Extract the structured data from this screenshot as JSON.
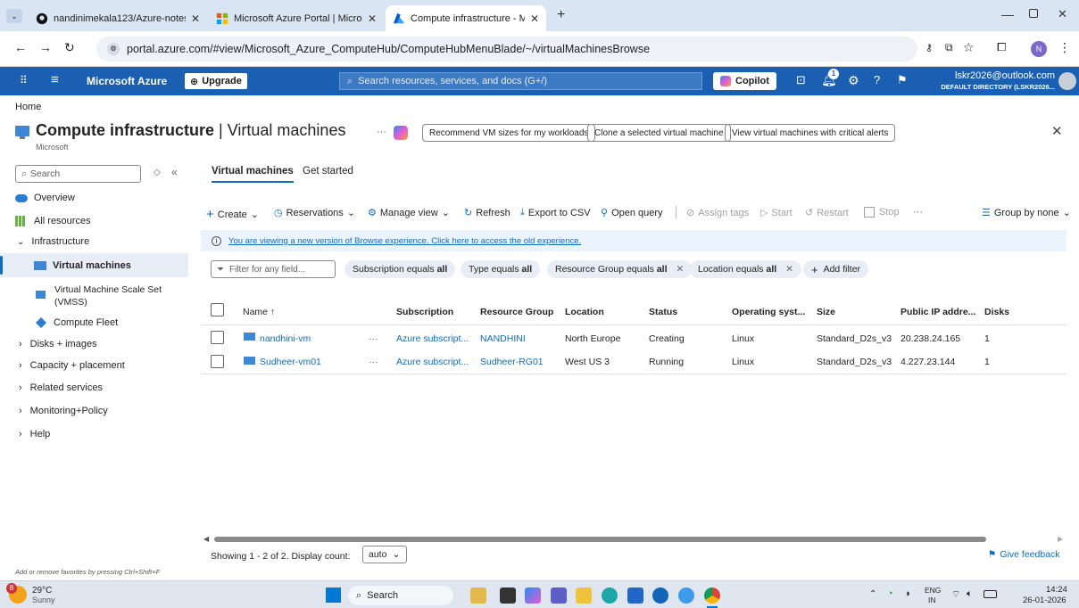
{
  "browser": {
    "tabs": [
      {
        "title": "nandinimekala123/Azure-notes",
        "icon": "github-icon"
      },
      {
        "title": "Microsoft Azure Portal | Micros",
        "icon": "microsoft-icon"
      },
      {
        "title": "Compute infrastructure - Micro",
        "icon": "azure-icon"
      }
    ],
    "url": "portal.azure.com/#view/Microsoft_Azure_ComputeHub/ComputeHubMenuBlade/~/virtualMachinesBrowse"
  },
  "azure_header": {
    "brand": "Microsoft Azure",
    "upgrade": "Upgrade",
    "search_placeholder": "Search resources, services, and docs (G+/)",
    "copilot": "Copilot",
    "notification_count": "1",
    "account_email": "lskr2026@outlook.com",
    "account_directory": "DEFAULT DIRECTORY (LSKR2026..."
  },
  "breadcrumb": "Home",
  "blade": {
    "title_main": "Compute infrastructure",
    "title_sep": " | ",
    "title_sub": "Virtual machines",
    "subtitle": "Microsoft",
    "more": "···",
    "suggestions": [
      "Recommend VM sizes for my workloads",
      "Clone a selected virtual machine",
      "View virtual machines with critical alerts"
    ]
  },
  "sidebar": {
    "search_placeholder": "Search",
    "items": [
      {
        "label": "Overview"
      },
      {
        "label": "All resources"
      },
      {
        "label": "Infrastructure"
      },
      {
        "label": "Virtual machines"
      },
      {
        "label": "Virtual Machine Scale Set"
      },
      {
        "label": "(VMSS)"
      },
      {
        "label": "Compute Fleet"
      },
      {
        "label": "Disks + images"
      },
      {
        "label": "Capacity + placement"
      },
      {
        "label": "Related services"
      },
      {
        "label": "Monitoring+Policy"
      },
      {
        "label": "Help"
      }
    ],
    "footer_hint": "Add or remove favorites by pressing Ctrl+Shift+F"
  },
  "tabs": {
    "active": "Virtual machines",
    "other": "Get started"
  },
  "toolbar": {
    "create": "Create",
    "reservations": "Reservations",
    "manage_view": "Manage view",
    "refresh": "Refresh",
    "export_csv": "Export to CSV",
    "open_query": "Open query",
    "assign_tags": "Assign tags",
    "start": "Start",
    "restart": "Restart",
    "stop": "Stop",
    "more": "···",
    "group_by": "Group by none"
  },
  "banner": "You are viewing a new version of Browse experience. Click here to access the old experience.",
  "filters": {
    "placeholder": "Filter for any field...",
    "chips": [
      {
        "label": "Subscription equals ",
        "value": "all"
      },
      {
        "label": "Type equals ",
        "value": "all"
      },
      {
        "label": "Resource Group equals ",
        "value": "all"
      },
      {
        "label": "Location equals ",
        "value": "all"
      }
    ],
    "add": "Add filter"
  },
  "table": {
    "columns": [
      "Name ↑",
      "Subscription",
      "Resource Group",
      "Location",
      "Status",
      "Operating syst...",
      "Size",
      "Public IP addre...",
      "Disks"
    ],
    "rows": [
      {
        "name": "nandhini-vm",
        "more": "···",
        "subscription": "Azure subscript...",
        "rg": "NANDHINI",
        "location": "North Europe",
        "status": "Creating",
        "os": "Linux",
        "size": "Standard_D2s_v3",
        "ip": "20.238.24.165",
        "disks": "1"
      },
      {
        "name": "Sudheer-vm01",
        "more": "···",
        "subscription": "Azure subscript...",
        "rg": "Sudheer-RG01",
        "location": "West US 3",
        "status": "Running",
        "os": "Linux",
        "size": "Standard_D2s_v3",
        "ip": "4.227.23.144",
        "disks": "1"
      }
    ]
  },
  "footer": {
    "showing": "Showing 1 - 2 of 2. Display count:",
    "count_value": "auto",
    "feedback": "Give feedback"
  },
  "taskbar": {
    "weather_badge": "8",
    "temperature": "29°C",
    "condition": "Sunny",
    "search": "Search",
    "lang1": "ENG",
    "lang2": "IN",
    "time": "14:24",
    "date": "26-01-2026"
  },
  "colors": {
    "azure_blue": "#1b5fb3",
    "link": "#0f6cbd",
    "tab_bar": "#dae5f3"
  }
}
